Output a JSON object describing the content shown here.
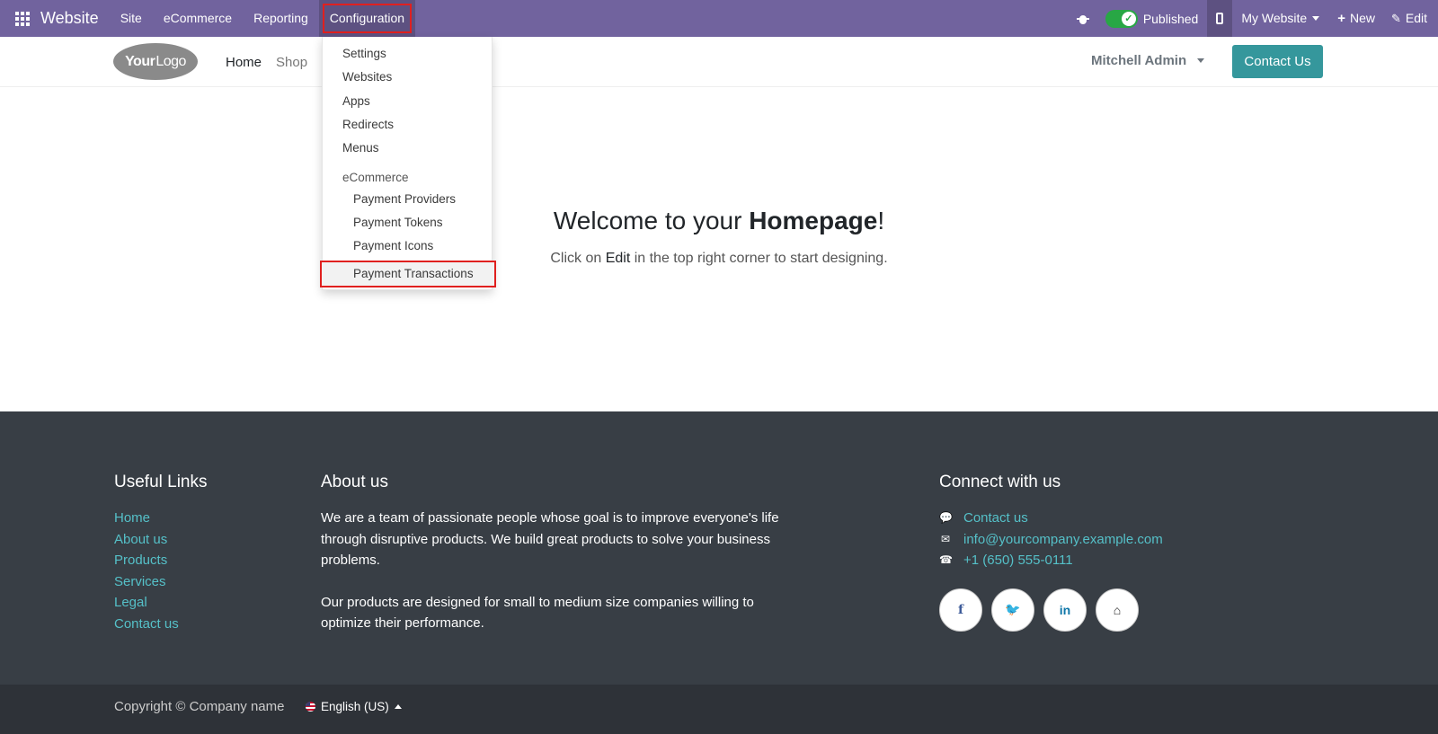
{
  "topbar": {
    "brand": "Website",
    "menu": [
      "Site",
      "eCommerce",
      "Reporting",
      "Configuration"
    ],
    "published_label": "Published",
    "site_selector": "My Website",
    "new_label": "New",
    "edit_label": "Edit",
    "bg_color": "#71639e"
  },
  "header": {
    "logo_your": "Your",
    "logo_logo": "Logo",
    "nav": [
      "Home",
      "Shop"
    ],
    "user": "Mitchell Admin",
    "contact_button": "Contact Us"
  },
  "dropdown": {
    "items": [
      "Settings",
      "Websites",
      "Apps",
      "Redirects",
      "Menus"
    ],
    "section": "eCommerce",
    "sub_items": [
      "Payment Providers",
      "Payment Tokens",
      "Payment Icons",
      "Payment Transactions"
    ],
    "highlighted": "Payment Transactions"
  },
  "hero": {
    "title_pre": "Welcome to your ",
    "title_bold": "Homepage",
    "title_post": "!",
    "sub_pre": "Click on ",
    "sub_bold": "Edit",
    "sub_post": " in the top right corner to start designing."
  },
  "footer": {
    "useful_links_title": "Useful Links",
    "useful_links": [
      "Home",
      "About us",
      "Products",
      "Services",
      "Legal",
      "Contact us"
    ],
    "about_title": "About us",
    "about_p1": "We are a team of passionate people whose goal is to improve everyone's life through disruptive products. We build great products to solve your business problems.",
    "about_p2": "Our products are designed for small to medium size companies willing to optimize their performance.",
    "connect_title": "Connect with us",
    "contact_link": "Contact us",
    "email": "info@yourcompany.example.com",
    "phone": "+1 (650) 555-0111",
    "socials": [
      "facebook-icon",
      "twitter-icon",
      "linkedin-icon",
      "home-icon"
    ],
    "link_color": "#55c0c8"
  },
  "copyright": {
    "text": "Copyright © Company name",
    "language": "English (US)"
  }
}
